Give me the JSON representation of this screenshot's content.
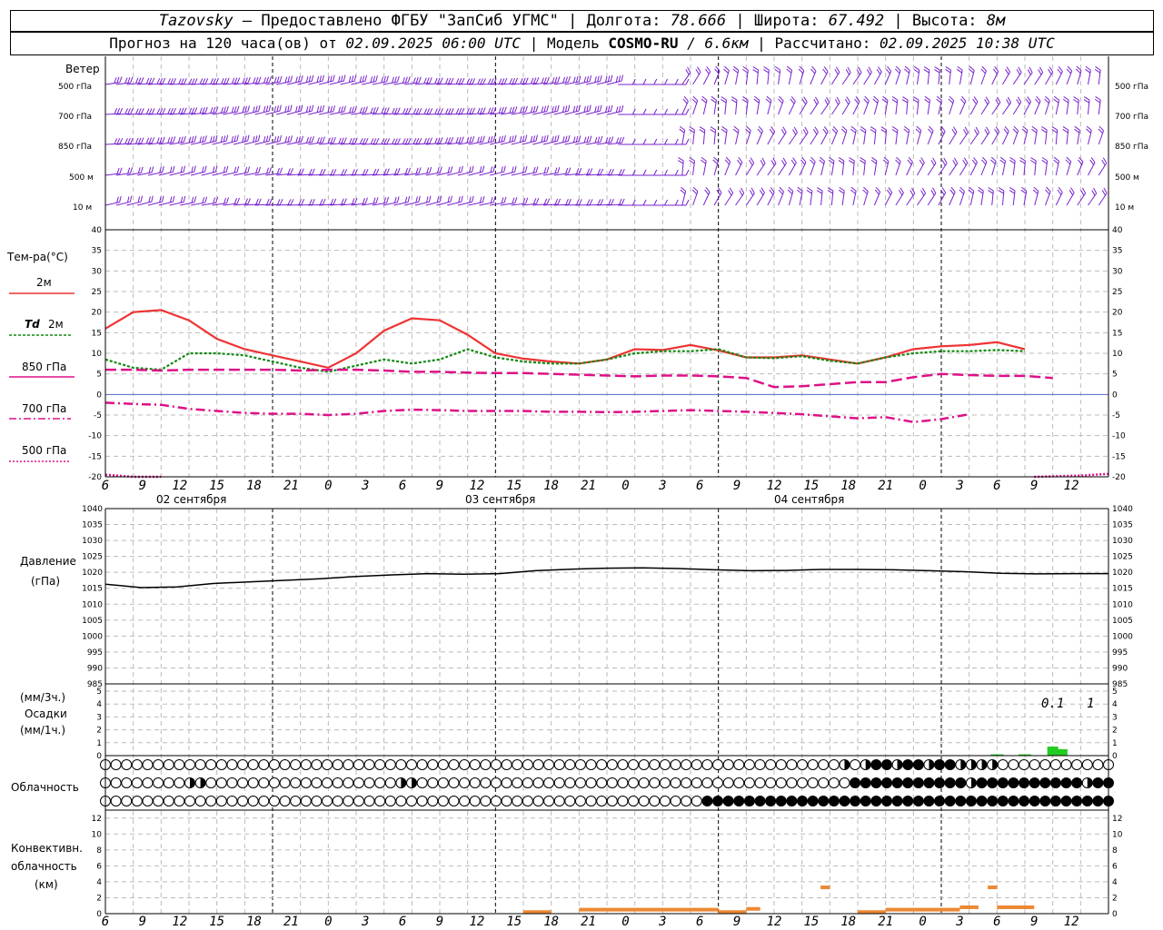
{
  "header": {
    "station": "Tazovsky",
    "provider": "– Предоставлено ФГБУ \"ЗапСиб УГМС\"",
    "lon_label": "Долгота:",
    "lon": "78.666",
    "lat_label": "Широта:",
    "lat": "67.492",
    "alt_label": "Высота:",
    "alt": "8м",
    "forecast_prefix": "Прогноз на 120 часа(ов) от",
    "forecast_time": "02.09.2025 06:00 UTC",
    "model_label": "| Модель",
    "model": "COSMO-RU",
    "model_res": "/ 6.6км",
    "calc_label": "| Рассчитано:",
    "calc_time": "02.09.2025 10:38 UTC"
  },
  "labels": {
    "wind": "Ветер",
    "levels": [
      "500 гПа",
      "700 гПа",
      "850 гПа",
      "500 м",
      "10 м"
    ],
    "temp_title": "Тем-ра(°С)",
    "temp_2m": "2м",
    "td_prefix": "Td",
    "td_2m": "2м",
    "t850": "850 гПа",
    "t700": "700 гПа",
    "t500": "500 гПа",
    "pressure_1": "Давление",
    "pressure_2": "(гПа)",
    "precip_1": "(мм/3ч.)",
    "precip_2": "Осадки",
    "precip_3": "(мм/1ч.)",
    "cloud": "Облачность",
    "conv_1": "Конвективн.",
    "conv_2": "облачность",
    "conv_3": "(км)",
    "precip_annot_1": "0.1",
    "precip_annot_2": "1"
  },
  "colors": {
    "t2m": "#ee3333",
    "td2m": "#118811",
    "t850": "#dd1188",
    "t700": "#dd1188",
    "t500": "#dd1188",
    "pressure": "#000000",
    "precip": "#22cc22",
    "conv": "#ee8833",
    "wind": "#7722cc"
  },
  "time_axis": {
    "hour_labels": [
      "6",
      "9",
      "12",
      "15",
      "18",
      "21",
      "0",
      "3",
      "6",
      "9",
      "12",
      "15",
      "18",
      "21",
      "0",
      "3",
      "6",
      "9",
      "12",
      "15",
      "18",
      "21",
      "0",
      "3",
      "6",
      "9",
      "12"
    ],
    "day_labels": [
      "02 сентября",
      "03 сентября",
      "04 сентября"
    ]
  },
  "chart_data": [
    {
      "type": "line",
      "name": "temperature",
      "ylim": [
        -20,
        40
      ],
      "y_ticks": [
        "40",
        "35",
        "30",
        "25",
        "20",
        "15",
        "10",
        "5",
        "0",
        "-5",
        "-10",
        "-15",
        "-20"
      ],
      "x_hours": [
        0,
        3,
        6,
        9,
        12,
        15,
        18,
        21,
        24,
        27,
        30,
        33,
        36,
        39,
        42,
        45,
        48,
        51,
        54,
        57,
        60,
        63,
        66,
        69,
        72,
        75,
        78,
        81,
        84,
        87,
        90,
        93,
        96,
        99,
        102,
        105,
        108
      ],
      "series": [
        {
          "name": "2м",
          "values": [
            16,
            20,
            20.5,
            18,
            13.5,
            11,
            9.5,
            8,
            6.5,
            10,
            15.5,
            18.5,
            18,
            14.5,
            10,
            8.7,
            8,
            7.5,
            8.5,
            11,
            10.8,
            12,
            10.7,
            9,
            9,
            9.5,
            8.5,
            7.5,
            9,
            11,
            11.7,
            12,
            12.7,
            11
          ]
        },
        {
          "name": "Td 2м",
          "values": [
            8.5,
            6.5,
            6,
            10,
            10,
            9.5,
            8,
            6.5,
            5.5,
            7,
            8.5,
            7.5,
            8.5,
            11,
            9,
            8,
            7.5,
            7.5,
            8.5,
            10,
            10.5,
            10.5,
            11,
            9,
            8.8,
            9.3,
            8.2,
            7.5,
            9,
            10,
            10.5,
            10.5,
            10.8,
            10.5
          ]
        },
        {
          "name": "850 гПа",
          "values": [
            6,
            6,
            5.8,
            6,
            6,
            6,
            6,
            5.8,
            6,
            6,
            5.8,
            5.5,
            5.5,
            5.3,
            5.2,
            5.2,
            5,
            4.8,
            4.6,
            4.4,
            4.6,
            4.6,
            4.4,
            4,
            1.8,
            2,
            2.5,
            3,
            3,
            4.2,
            5,
            4.7,
            4.5,
            4.5,
            4
          ]
        },
        {
          "name": "700 гПа",
          "values": [
            -2,
            -2.3,
            -2.5,
            -3.5,
            -4,
            -4.5,
            -4.7,
            -4.7,
            -5,
            -4.7,
            -4,
            -3.7,
            -3.8,
            -4,
            -4,
            -4,
            -4.2,
            -4.2,
            -4.3,
            -4.2,
            -4,
            -3.8,
            -4,
            -4.2,
            -4.5,
            -4.8,
            -5.3,
            -5.8,
            -5.5,
            -6.7,
            -6,
            -4.8
          ]
        },
        {
          "name": "500 гПа",
          "values": [
            -19.5,
            -20,
            -20
          ]
        }
      ]
    },
    {
      "type": "line",
      "name": "pressure",
      "ylim": [
        985,
        1040
      ],
      "y_ticks": [
        "1040",
        "1035",
        "1030",
        "1025",
        "1020",
        "1015",
        "1010",
        "1005",
        "1000",
        "995",
        "990",
        "985"
      ],
      "series": [
        {
          "values": [
            1016.3,
            1015.2,
            1015.4,
            1016.5,
            1017,
            1017.5,
            1018,
            1018.7,
            1019.2,
            1019.6,
            1019.4,
            1019.6,
            1020.5,
            1021,
            1021.3,
            1021.4,
            1021.2,
            1020.8,
            1020.5,
            1020.6,
            1020.9,
            1020.9,
            1020.8,
            1020.5,
            1020.2,
            1019.7,
            1019.5,
            1019.6,
            1019.6
          ]
        }
      ]
    },
    {
      "type": "bar",
      "name": "precipitation",
      "ylim": [
        0,
        5
      ],
      "y_ticks": [
        "5",
        "4",
        "3",
        "2",
        "1",
        "0"
      ],
      "hours": [
        96,
        99,
        102,
        103
      ],
      "values": [
        0.1,
        0.1,
        0.7,
        0.5
      ]
    },
    {
      "type": "bar",
      "name": "convective cloud",
      "ylim": [
        0,
        13
      ],
      "y_ticks": [
        "12",
        "10",
        "8",
        "6",
        "4",
        "2",
        "0"
      ],
      "segments": [
        {
          "from": 45,
          "to": 48,
          "top": 0.2
        },
        {
          "from": 51,
          "to": 66,
          "top": 0.5
        },
        {
          "from": 66,
          "to": 69,
          "top": 0.2
        },
        {
          "from": 69,
          "to": 70.5,
          "top": 0.6
        },
        {
          "from": 77,
          "to": 78,
          "top": 3.3
        },
        {
          "from": 81,
          "to": 84,
          "top": 0.2
        },
        {
          "from": 84,
          "to": 92,
          "top": 0.5
        },
        {
          "from": 92,
          "to": 94,
          "top": 0.8
        },
        {
          "from": 95,
          "to": 96,
          "top": 3.3
        },
        {
          "from": 96,
          "to": 100,
          "top": 0.8
        }
      ]
    }
  ]
}
